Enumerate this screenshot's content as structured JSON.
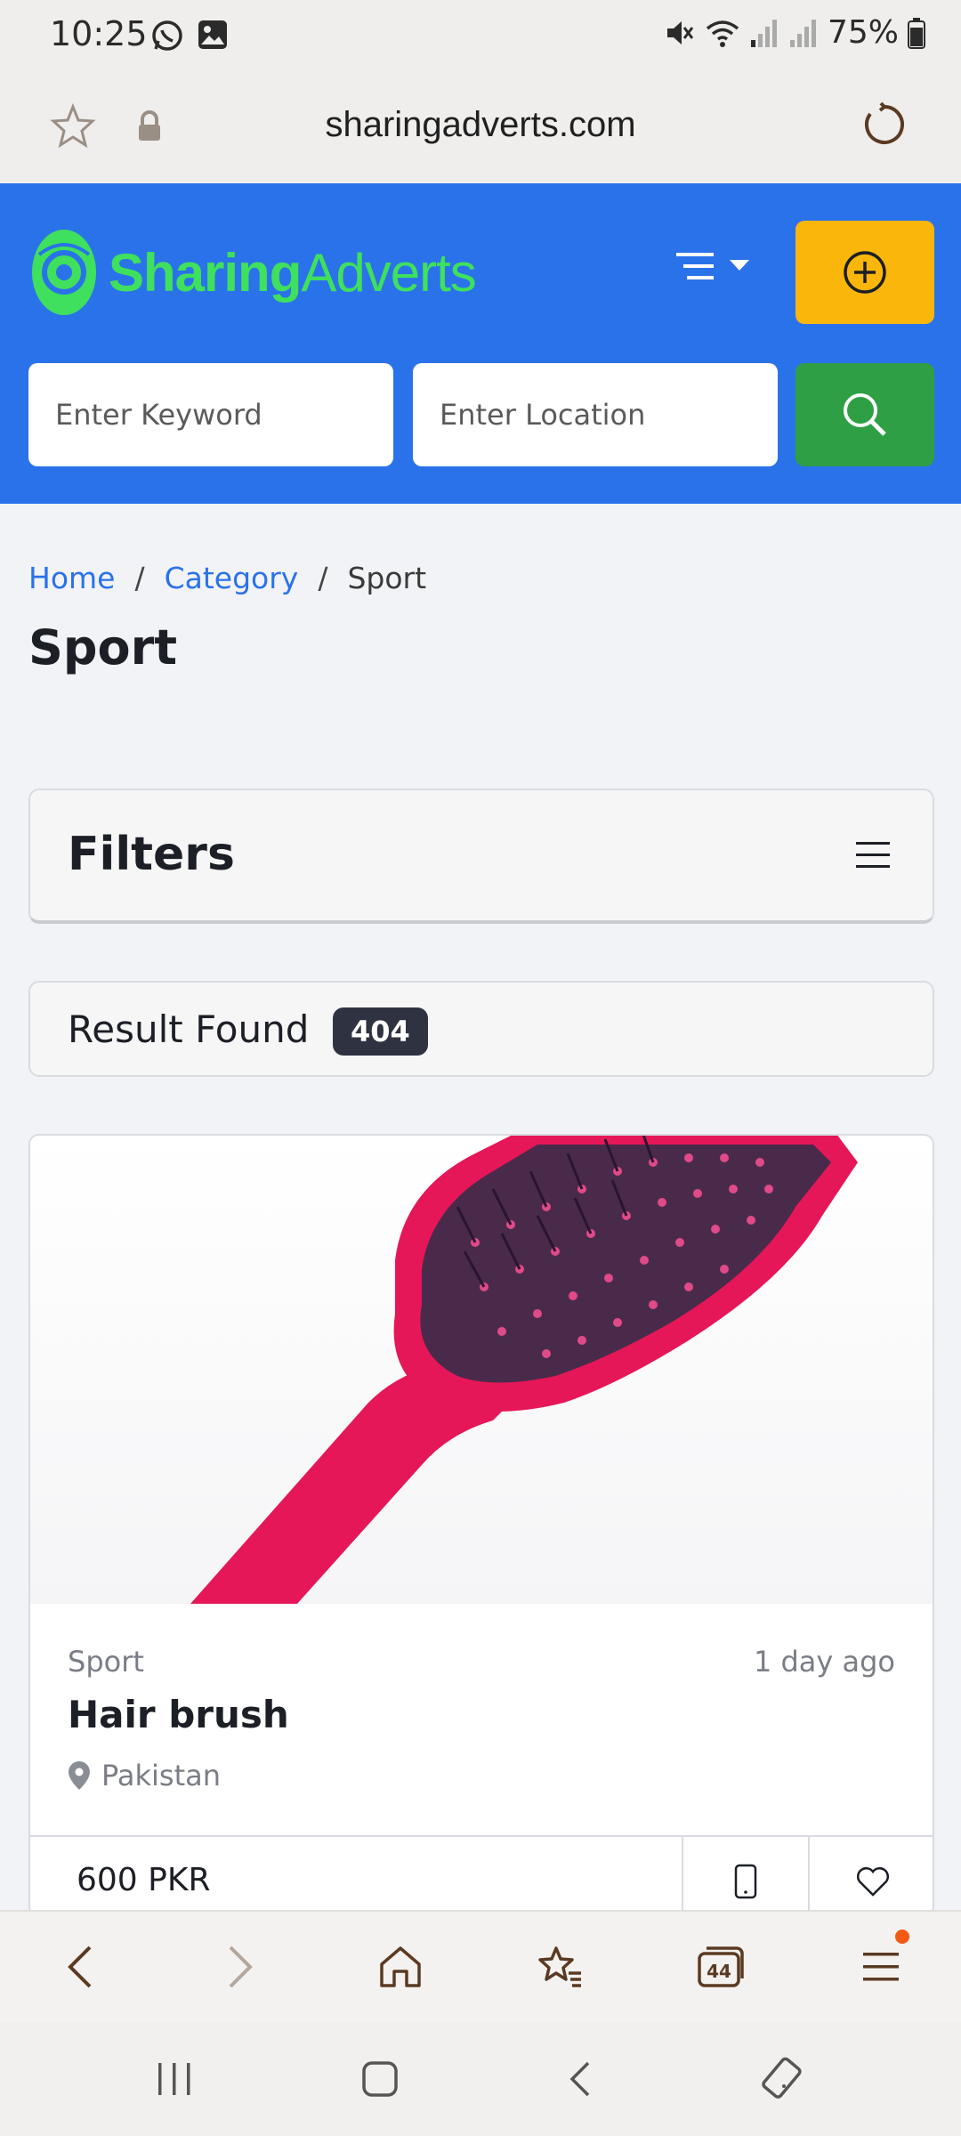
{
  "status_bar": {
    "time": "10:25",
    "battery": "75%"
  },
  "browser": {
    "url": "sharingadverts.com"
  },
  "header": {
    "logo_part1": "Sharing",
    "logo_part2": "Adverts",
    "keyword_placeholder": "Enter Keyword",
    "location_placeholder": "Enter Location",
    "colors": {
      "header_bg": "#2a72ea",
      "post_button": "#fbb60b",
      "search_button": "#2e9f44",
      "logo": "#3fe05d"
    }
  },
  "breadcrumb": {
    "home": "Home",
    "sep": "/",
    "category": "Category",
    "current": "Sport"
  },
  "page_title": "Sport",
  "filters": {
    "title": "Filters"
  },
  "results": {
    "label": "Result Found",
    "count": "404"
  },
  "ad": {
    "category": "Sport",
    "posted": "1 day ago",
    "title": "Hair brush",
    "location": "Pakistan",
    "price": "600 PKR"
  },
  "browser_nav": {
    "tabs_count": "44"
  }
}
